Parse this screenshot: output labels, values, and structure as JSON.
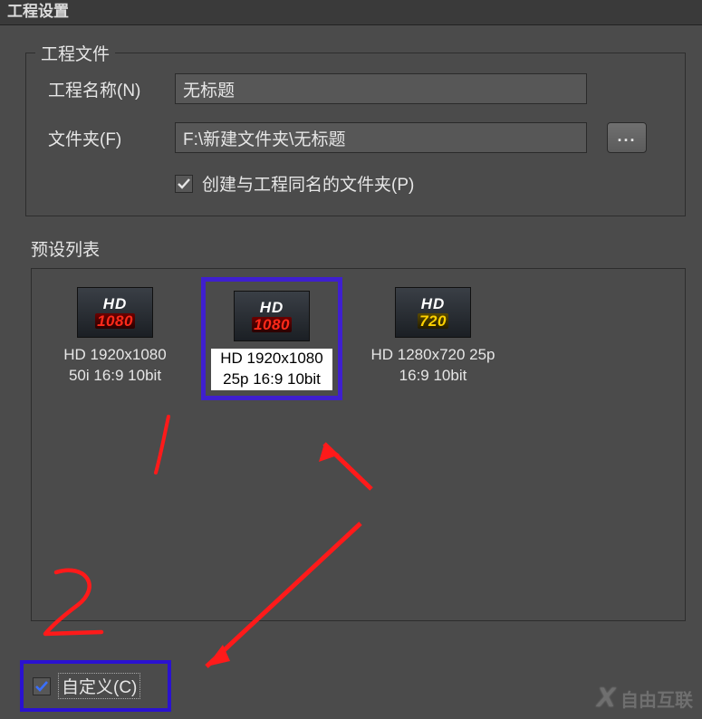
{
  "window": {
    "title": "工程设置"
  },
  "project_file": {
    "legend": "工程文件",
    "name_label": "工程名称(N)",
    "name_value": "无标题",
    "folder_label": "文件夹(F)",
    "folder_value": "F:\\新建文件夹\\无标题",
    "browse_glyph": "...",
    "create_same_label": "创建与工程同名的文件夹(P)",
    "create_same_checked": true
  },
  "preset": {
    "section_label": "预设列表",
    "items": [
      {
        "hd": "HD",
        "res_text": "1080",
        "res_class": "red",
        "line1": "HD 1920x1080",
        "line2": "50i 16:9 10bit",
        "selected": false
      },
      {
        "hd": "HD",
        "res_text": "1080",
        "res_class": "red",
        "line1": "HD 1920x1080",
        "line2": "25p 16:9 10bit",
        "selected": true
      },
      {
        "hd": "HD",
        "res_text": "720",
        "res_class": "yellow",
        "line1": "HD 1280x720 25p",
        "line2": "16:9 10bit",
        "selected": false
      }
    ]
  },
  "custom": {
    "label": "自定义(C)",
    "checked": true
  },
  "watermark": {
    "logo": "X",
    "text": "自由互联"
  },
  "annotations": {
    "mark1": "1",
    "mark2": "2"
  },
  "colors": {
    "highlight": "#3f1fcf",
    "annotation": "#ff1a1a"
  }
}
